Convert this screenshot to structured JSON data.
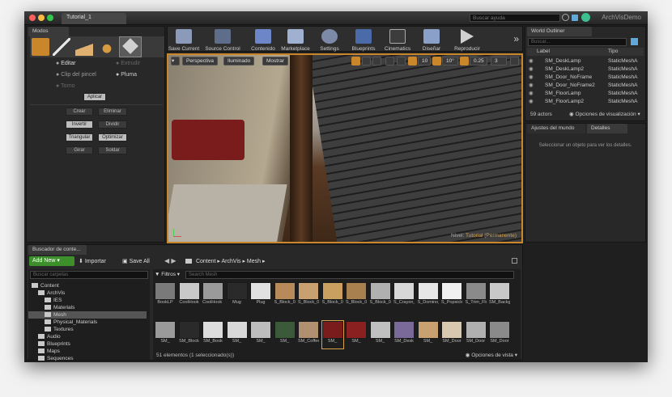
{
  "window": {
    "tab_title": "Tutorial_1",
    "help_search_placeholder": "Buscar ayuda",
    "app_name": "ArchVisDemo"
  },
  "modes": {
    "tab": "Modos",
    "options": [
      "Editar",
      "Extrudir",
      "Clip del pincel",
      "Pluma",
      "Torno"
    ],
    "apply": "Aplicar",
    "buttons": [
      "Crear",
      "Eliminar",
      "Invertir",
      "Dividir",
      "Triangular",
      "Optimizar",
      "Girar",
      "Soldar"
    ]
  },
  "toolbar": {
    "items": [
      "Save Current",
      "Source Control",
      "Contenido",
      "Marketplace",
      "Settings",
      "Blueprints",
      "Cinematics",
      "Diseñar",
      "Reproducir"
    ],
    "more": "»"
  },
  "viewport": {
    "perspective": "Perspectiva",
    "lit": "Iluminado",
    "show": "Mostrar",
    "grid_snap": "10",
    "angle_snap": "10°",
    "scale_snap": "0.25",
    "cam_speed": "3",
    "level_label": "Nivel:",
    "level_name": "Tutorial (Permanente)"
  },
  "outliner": {
    "tab": "World Outliner",
    "search_placeholder": "Buscar...",
    "col_label": "Label",
    "col_type": "Tipo",
    "rows": [
      {
        "label": "SM_DeskLamp",
        "type": "StaticMeshA"
      },
      {
        "label": "SM_DeskLamp2",
        "type": "StaticMeshA"
      },
      {
        "label": "SM_Door_NoFrame",
        "type": "StaticMeshA"
      },
      {
        "label": "SM_Door_NoFrame2",
        "type": "StaticMeshA"
      },
      {
        "label": "SM_FloorLamp",
        "type": "StaticMeshA"
      },
      {
        "label": "SM_FloorLamp2",
        "type": "StaticMeshA"
      }
    ],
    "count": "59 actors",
    "view_options": "Opciones de visualización"
  },
  "details": {
    "tab_world": "Ajustes del mundo",
    "tab_details": "Detalles",
    "empty_msg": "Seleccionar un objeto para ver los detalles."
  },
  "content_browser": {
    "tab": "Buscador de conte...",
    "add_new": "Add New",
    "import": "Importar",
    "save_all": "Save All",
    "path": [
      "Content",
      "ArchVis",
      "Mesh"
    ],
    "folder_search": "Buscar carpetas",
    "filters": "Filtros",
    "asset_search": "Search Mesh",
    "tree": [
      {
        "label": "Content",
        "indent": 0
      },
      {
        "label": "ArchVis",
        "indent": 1
      },
      {
        "label": "IES",
        "indent": 2
      },
      {
        "label": "Materials",
        "indent": 2
      },
      {
        "label": "Mesh",
        "indent": 2,
        "selected": true
      },
      {
        "label": "Physical_Materials",
        "indent": 2
      },
      {
        "label": "Textures",
        "indent": 2
      },
      {
        "label": "Audio",
        "indent": 1
      },
      {
        "label": "Blueprints",
        "indent": 1
      },
      {
        "label": "Maps",
        "indent": 1
      },
      {
        "label": "Sequences",
        "indent": 1
      }
    ],
    "assets_row1": [
      "BookLP",
      "CoolHook",
      "CoolHook Backing",
      "Mug",
      "Plug",
      "S_Block_01",
      "S_Block_02",
      "S_Block_05",
      "S_Block_07",
      "S_Block_09",
      "S_Crayon_A",
      "S_Domino_Single_01",
      "S_Popsicle Stick_01",
      "S_Trim_Floor",
      "SM_Background"
    ],
    "assets_row2": [
      "SM_",
      "SM_Block",
      "SM_Book",
      "SM_",
      "SM_",
      "SM_",
      "SM_Coffee",
      "SM_",
      "SM_",
      "SM_",
      "SM_Desk",
      "SM_",
      "SM_Door",
      "SM_Door",
      "SM_Door"
    ],
    "status": "51 elementos (1 seleccionado(s))",
    "view_options": "Opciones de vista"
  },
  "colors": {
    "accent": "#f0a030",
    "add_new_green": "#3c8f2a",
    "selection_blue": "#2b5f8e"
  }
}
